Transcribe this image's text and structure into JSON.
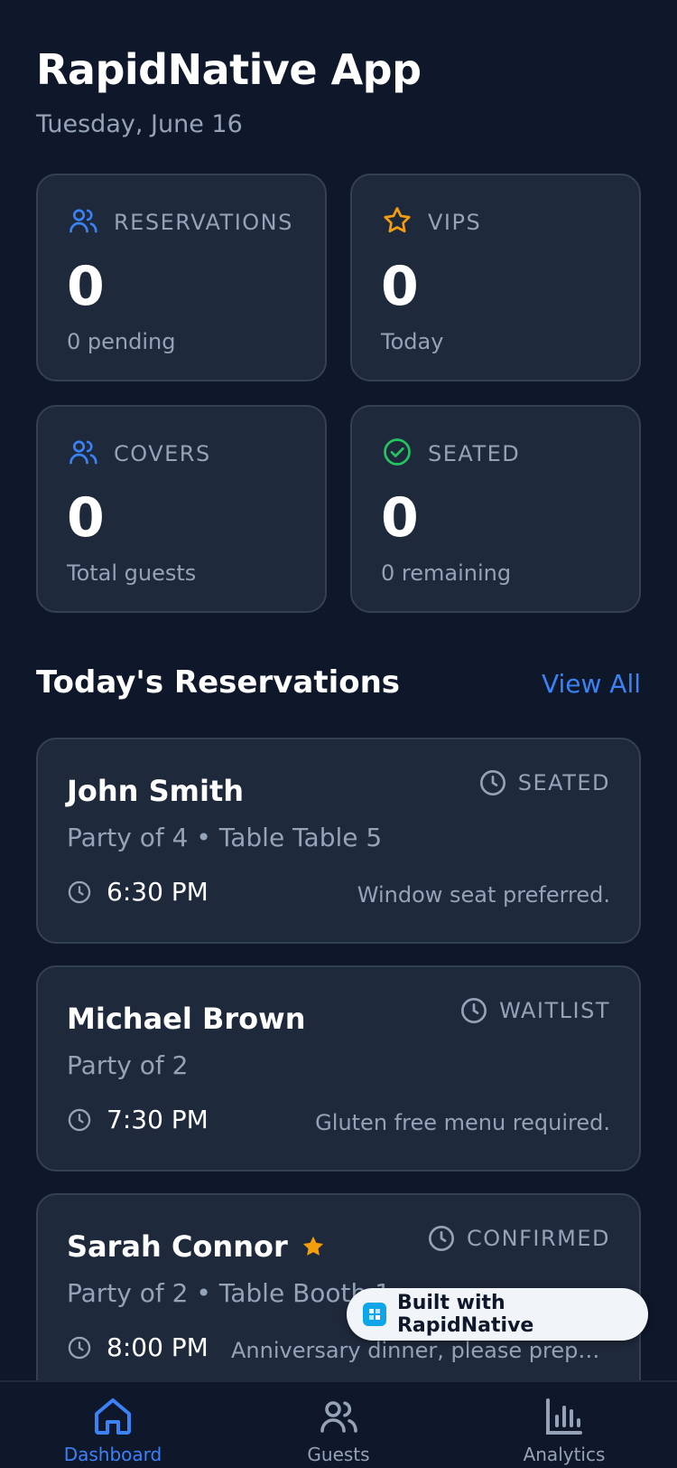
{
  "header": {
    "title": "RapidNative App",
    "date": "Tuesday, June 16"
  },
  "stats": [
    {
      "icon": "users-icon",
      "label": "RESERVATIONS",
      "value": "0",
      "sub": "0 pending",
      "color": "#3b82f6"
    },
    {
      "icon": "star-icon",
      "label": "VIPS",
      "value": "0",
      "sub": "Today",
      "color": "#f59e0b"
    },
    {
      "icon": "users-icon",
      "label": "COVERS",
      "value": "0",
      "sub": "Total guests",
      "color": "#3b82f6"
    },
    {
      "icon": "check-circle-icon",
      "label": "SEATED",
      "value": "0",
      "sub": "0 remaining",
      "color": "#22c55e"
    }
  ],
  "reservations_section": {
    "title": "Today's Reservations",
    "view_all": "View All"
  },
  "reservations": [
    {
      "name": "John Smith",
      "vip": false,
      "status": "SEATED",
      "party": "Party of 4 • Table Table 5",
      "time": "6:30 PM",
      "note": "Window seat preferred."
    },
    {
      "name": "Michael Brown",
      "vip": false,
      "status": "WAITLIST",
      "party": "Party of 2",
      "time": "7:30 PM",
      "note": "Gluten free menu required."
    },
    {
      "name": "Sarah Connor",
      "vip": true,
      "status": "CONFIRMED",
      "party": "Party of 2 • Table Booth 1",
      "time": "8:00 PM",
      "note": "Anniversary dinner, please prepare ..."
    }
  ],
  "badge": {
    "text": "Built with RapidNative"
  },
  "tabs": [
    {
      "label": "Dashboard",
      "icon": "home-icon",
      "active": true
    },
    {
      "label": "Guests",
      "icon": "users-icon",
      "active": false
    },
    {
      "label": "Analytics",
      "icon": "bar-chart-icon",
      "active": false
    }
  ],
  "colors": {
    "background": "#0f172a",
    "card": "#1e293b",
    "accent": "#3b82f6",
    "muted": "#94a3b8",
    "vip": "#f59e0b",
    "success": "#22c55e"
  }
}
